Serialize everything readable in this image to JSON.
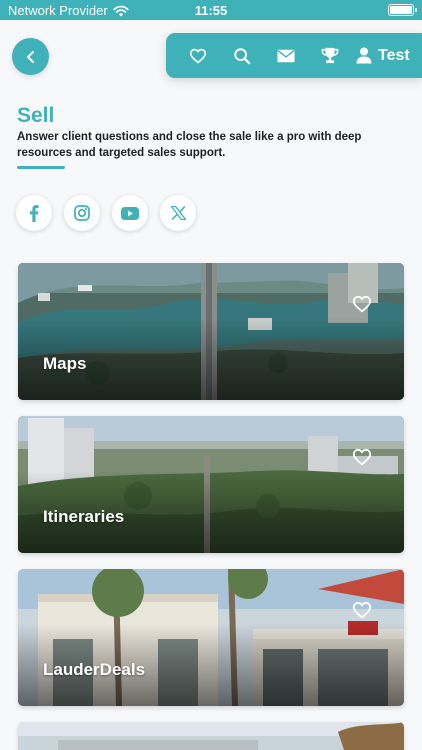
{
  "status_bar": {
    "carrier": "Network Provider",
    "time": "11:55",
    "icons": [
      "wifi-icon",
      "battery-icon"
    ]
  },
  "header": {
    "back_icon": "chevron-left-icon",
    "nav_icons": [
      "heart-icon",
      "search-icon",
      "mail-icon",
      "trophy-icon"
    ],
    "profile_icon": "user-icon",
    "profile_name": "Test"
  },
  "page": {
    "title": "Sell",
    "subtitle": "Answer client questions and close the sale like a pro with deep resources and targeted sales support."
  },
  "social": [
    "facebook-icon",
    "instagram-icon",
    "youtube-icon",
    "x-icon"
  ],
  "cards": [
    {
      "label": "Maps",
      "favorite_icon": "heart-outline-icon"
    },
    {
      "label": "Itineraries",
      "favorite_icon": "heart-outline-icon"
    },
    {
      "label": "LauderDeals",
      "favorite_icon": "heart-outline-icon"
    },
    {
      "label": ""
    }
  ],
  "colors": {
    "accent": "#3fb1b8",
    "background": "#f7f8fa",
    "white": "#ffffff"
  }
}
